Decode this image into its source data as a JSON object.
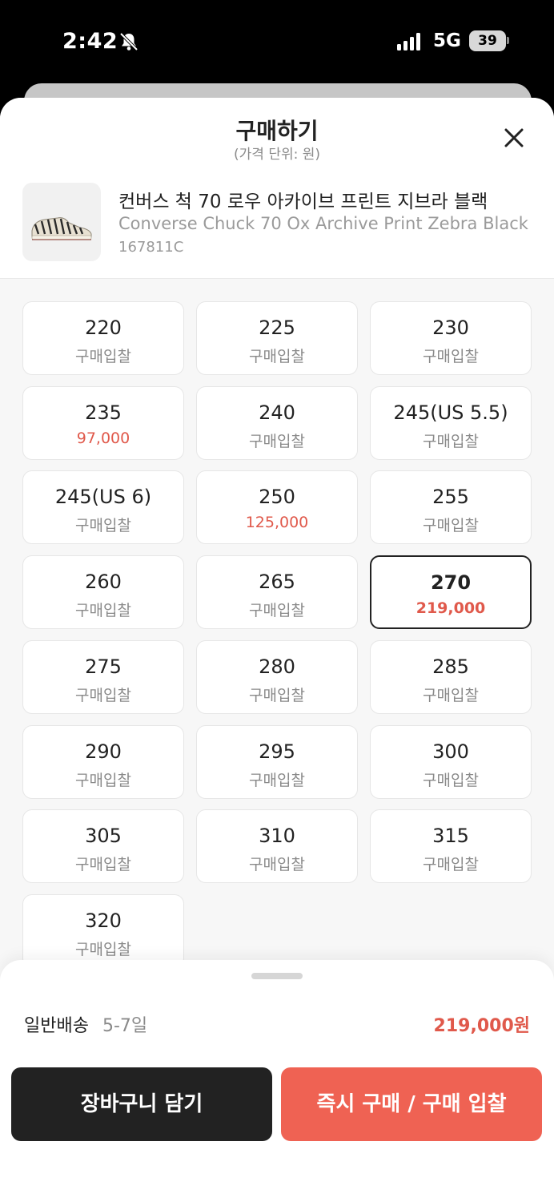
{
  "status_bar": {
    "time": "2:42",
    "network": "5G",
    "battery": "39",
    "icons": [
      "bell-slash-icon",
      "signal-icon",
      "battery-icon"
    ]
  },
  "sheet": {
    "title": "구매하기",
    "subtitle": "(가격 단위: 원)",
    "close_icon": "close-icon"
  },
  "product": {
    "name_ko": "컨버스 척 70 로우 아카이브 프린트 지브라 블랙",
    "name_en": "Converse Chuck 70 Ox Archive Print Zebra Black",
    "code": "167811C",
    "thumbnail": "zebra-sneaker-image"
  },
  "sizes": [
    {
      "size": "220",
      "price": "구매입찰",
      "has_price": false
    },
    {
      "size": "225",
      "price": "구매입찰",
      "has_price": false
    },
    {
      "size": "230",
      "price": "구매입찰",
      "has_price": false
    },
    {
      "size": "235",
      "price": "97,000",
      "has_price": true
    },
    {
      "size": "240",
      "price": "구매입찰",
      "has_price": false
    },
    {
      "size": "245(US 5.5)",
      "price": "구매입찰",
      "has_price": false
    },
    {
      "size": "245(US 6)",
      "price": "구매입찰",
      "has_price": false
    },
    {
      "size": "250",
      "price": "125,000",
      "has_price": true
    },
    {
      "size": "255",
      "price": "구매입찰",
      "has_price": false
    },
    {
      "size": "260",
      "price": "구매입찰",
      "has_price": false
    },
    {
      "size": "265",
      "price": "구매입찰",
      "has_price": false
    },
    {
      "size": "270",
      "price": "219,000",
      "has_price": true,
      "selected": true
    },
    {
      "size": "275",
      "price": "구매입찰",
      "has_price": false
    },
    {
      "size": "280",
      "price": "구매입찰",
      "has_price": false
    },
    {
      "size": "285",
      "price": "구매입찰",
      "has_price": false
    },
    {
      "size": "290",
      "price": "구매입찰",
      "has_price": false
    },
    {
      "size": "295",
      "price": "구매입찰",
      "has_price": false
    },
    {
      "size": "300",
      "price": "구매입찰",
      "has_price": false
    },
    {
      "size": "305",
      "price": "구매입찰",
      "has_price": false
    },
    {
      "size": "310",
      "price": "구매입찰",
      "has_price": false
    },
    {
      "size": "315",
      "price": "구매입찰",
      "has_price": false
    },
    {
      "size": "320",
      "price": "구매입찰",
      "has_price": false
    }
  ],
  "footer": {
    "delivery_label": "일반배송",
    "delivery_days": "5-7일",
    "total_price": "219,000원",
    "cart_button": "장바구니 담기",
    "buy_button": "즉시 구매 / 구매 입찰"
  },
  "colors": {
    "accent": "#ef6253",
    "price_red": "#e0594b",
    "dark_button": "#222222"
  }
}
